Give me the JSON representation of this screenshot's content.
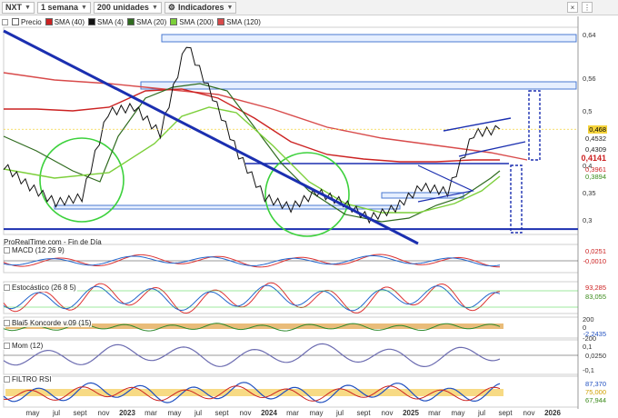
{
  "toolbar": {
    "symbol": "NXT",
    "period": "1 semana",
    "units": "200 unidades",
    "indicators": "Indicadores",
    "close_icon": "×",
    "menu_icon": "⋮"
  },
  "legend": {
    "items": [
      {
        "label": "Precio",
        "color": "#ffffff"
      },
      {
        "label": "SMA (40)",
        "color": "#cc2222"
      },
      {
        "label": "SMA (4)",
        "color": "#111111"
      },
      {
        "label": "SMA (20)",
        "color": "#2f6b1f"
      },
      {
        "label": "SMA (200)",
        "color": "#7ccf3a"
      },
      {
        "label": "SMA (120)",
        "color": "#d84a4a"
      }
    ]
  },
  "source": "ProRealTime.com - Fin de Día",
  "panels": {
    "macd": {
      "label": "MACD (12 26 9)",
      "values": [
        "0,0251",
        "-0,0010"
      ]
    },
    "stoch": {
      "label": "Estocástico (26 8 5)",
      "values": [
        "93,285",
        "83,055"
      ]
    },
    "koncorde": {
      "label": "Blai5 Koncorde v.09 (15)",
      "ticks": [
        "200",
        "0",
        "-200"
      ],
      "values": [
        "-2,2435"
      ]
    },
    "mom": {
      "label": "Mom (12)",
      "ticks": [
        "0,1",
        "-0,1"
      ],
      "values": [
        "0,0250"
      ]
    },
    "rsi": {
      "label": "FILTRO RSI",
      "values": [
        "87,370",
        "75,000",
        "67,944"
      ]
    }
  },
  "price_axis": {
    "ticks": [
      "0,64",
      "0,56",
      "0,5",
      "0,4",
      "0,35",
      "0,3"
    ]
  },
  "price_values": [
    {
      "text": "0,468",
      "bg": "#f5d33b",
      "color": "#000000"
    },
    {
      "text": "0,4532",
      "bg": "#ffffff",
      "color": "#222222"
    },
    {
      "text": "0,4309",
      "bg": "#ffffff",
      "color": "#222222"
    },
    {
      "text": "0,4141",
      "bg": "#ffffff",
      "color": "#cc2222"
    },
    {
      "text": "0,3961",
      "bg": "#ffffff",
      "color": "#cc2222"
    },
    {
      "text": "0,3894",
      "bg": "#ffffff",
      "color": "#3a8a1a"
    }
  ],
  "x_axis": {
    "labels": [
      "may",
      "jul",
      "sept",
      "nov",
      "2023",
      "mar",
      "may",
      "jul",
      "sept",
      "nov",
      "2024",
      "mar",
      "may",
      "jul",
      "sept",
      "nov",
      "2025",
      "mar",
      "may",
      "jul",
      "sept",
      "nov",
      "2026"
    ]
  },
  "chart_data": {
    "type": "line",
    "title": "",
    "series_name": "NXT",
    "x": [
      "2022-05",
      "2022-07",
      "2022-09",
      "2022-11",
      "2023-01",
      "2023-03",
      "2023-05",
      "2023-07",
      "2023-09",
      "2023-11",
      "2024-01",
      "2024-03",
      "2024-05",
      "2024-07",
      "2024-09",
      "2024-11",
      "2025-01",
      "2025-03",
      "2025-05",
      "2025-07"
    ],
    "close": [
      0.4,
      0.36,
      0.33,
      0.34,
      0.5,
      0.51,
      0.46,
      0.63,
      0.53,
      0.42,
      0.34,
      0.32,
      0.35,
      0.33,
      0.3,
      0.32,
      0.36,
      0.35,
      0.46,
      0.468
    ],
    "horizontal_levels": [
      0.64,
      0.56,
      0.39,
      0.335,
      0.28
    ],
    "last_price": 0.468,
    "ylim": [
      0.27,
      0.66
    ]
  }
}
